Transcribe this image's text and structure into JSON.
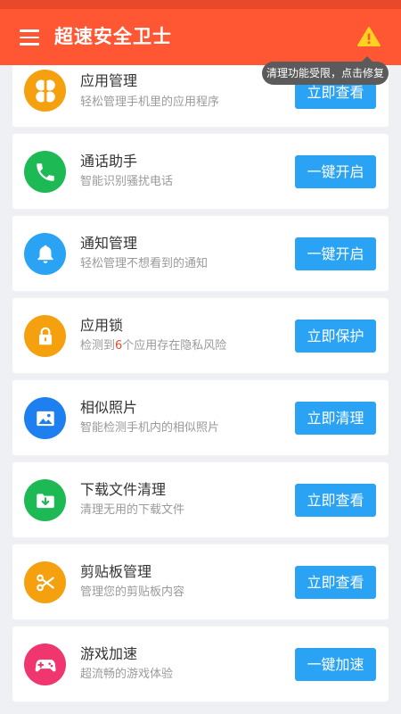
{
  "header": {
    "title": "超速安全卫士",
    "menu_icon": "menu-icon",
    "warning_icon": "warning-icon",
    "tooltip": "清理功能受限，点击修复",
    "colors": {
      "header_bg": "#ff5633",
      "button": "#2aa3f5",
      "highlight": "#e8492a"
    }
  },
  "items": [
    {
      "title": "应用管理",
      "desc": "轻松管理手机里的应用程序",
      "button": "立即查看",
      "icon": "app-grid-icon",
      "color": "#f5a00f"
    },
    {
      "title": "通话助手",
      "desc": "智能识别骚扰电话",
      "button": "一键开启",
      "icon": "phone-icon",
      "color": "#1db954"
    },
    {
      "title": "通知管理",
      "desc": "轻松管理不想看到的通知",
      "button": "一键开启",
      "icon": "bell-icon",
      "color": "#2aa3f5"
    },
    {
      "title": "应用锁",
      "desc_prefix": "检测到",
      "desc_count": "6",
      "desc_suffix": "个应用存在隐私风险",
      "button": "立即保护",
      "icon": "lock-icon",
      "color": "#f5a00f"
    },
    {
      "title": "相似照片",
      "desc": "智能检测手机内的相似照片",
      "button": "立即清理",
      "icon": "photo-icon",
      "color": "#1e7ff0"
    },
    {
      "title": "下载文件清理",
      "desc": "清理无用的下载文件",
      "button": "立即查看",
      "icon": "download-folder-icon",
      "color": "#1db954"
    },
    {
      "title": "剪贴板管理",
      "desc": "管理您的剪贴板内容",
      "button": "立即查看",
      "icon": "scissors-icon",
      "color": "#f5a00f"
    },
    {
      "title": "游戏加速",
      "desc": "超流畅的游戏体验",
      "button": "一键加速",
      "icon": "gamepad-icon",
      "color": "#f0366e"
    }
  ]
}
